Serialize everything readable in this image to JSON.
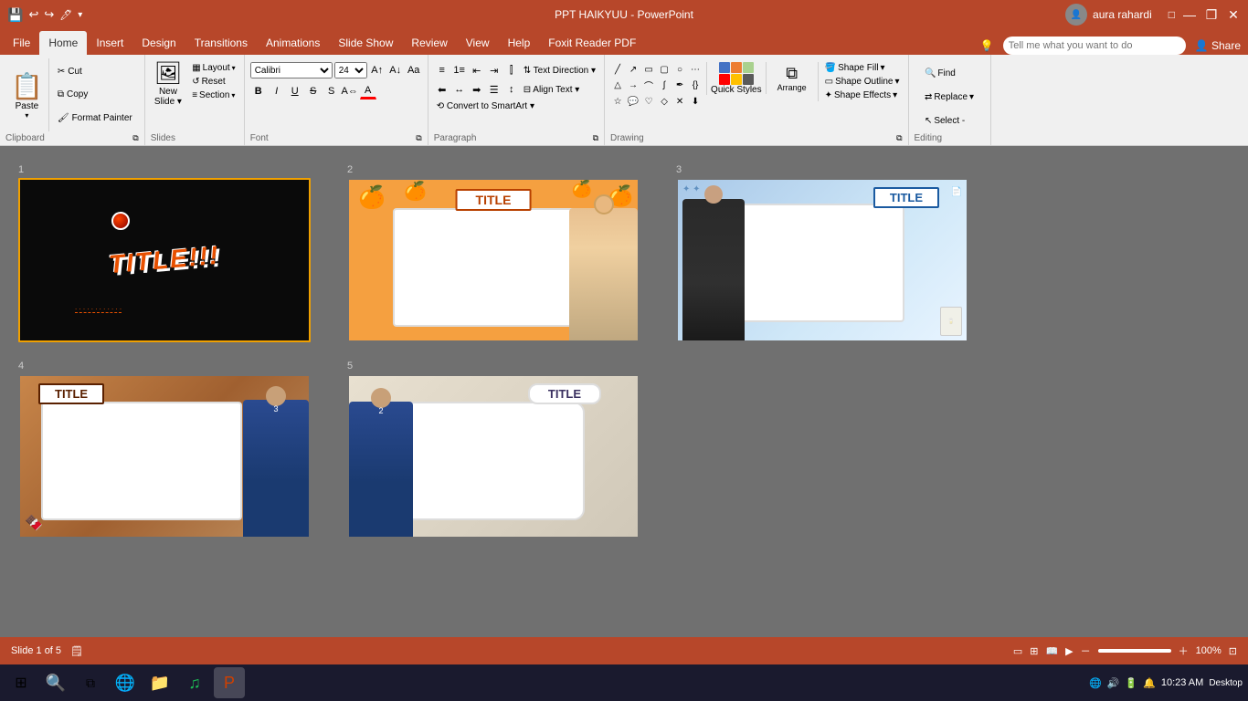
{
  "titlebar": {
    "title": "PPT HAIKYUU - PowerPoint",
    "user": "aura rahardi",
    "save_icon": "💾",
    "undo_icon": "↩",
    "redo_icon": "↪",
    "close": "✕",
    "minimize": "—",
    "maximize": "❐"
  },
  "ribbon": {
    "tabs": [
      "File",
      "Home",
      "Insert",
      "Design",
      "Transitions",
      "Animations",
      "Slide Show",
      "Review",
      "View",
      "Help",
      "Foxit Reader PDF"
    ],
    "active_tab": "Home",
    "tell_me": "Tell me what you want to do",
    "share": "Share",
    "groups": {
      "clipboard": {
        "label": "Clipboard",
        "paste": "Paste",
        "cut": "Cut",
        "copy": "Copy",
        "format_painter": "Format Painter"
      },
      "slides": {
        "label": "Slides",
        "new_slide": "New Slide",
        "layout": "Layout",
        "reset": "Reset",
        "section": "Section"
      },
      "font": {
        "label": "Font",
        "font_name": "Calibri",
        "font_size": "24",
        "bold": "B",
        "italic": "I",
        "underline": "U",
        "strikethrough": "S",
        "shadow": "S"
      },
      "paragraph": {
        "label": "Paragraph"
      },
      "drawing": {
        "label": "Drawing",
        "shape_fill": "Shape Fill",
        "shape_outline": "Shape Outline",
        "shape_effects": "Shape Effects",
        "quick_styles": "Quick Styles",
        "arrange": "Arrange"
      },
      "editing": {
        "label": "Editing",
        "find": "Find",
        "replace": "Replace",
        "select": "Select"
      }
    }
  },
  "slides": [
    {
      "number": "1",
      "title": "TITLE!!!",
      "theme": "black",
      "selected": true
    },
    {
      "number": "2",
      "title": "TITLE",
      "theme": "orange"
    },
    {
      "number": "3",
      "title": "TITLE",
      "theme": "blue"
    },
    {
      "number": "4",
      "title": "TITLE",
      "theme": "brown"
    },
    {
      "number": "5",
      "title": "TITLE",
      "theme": "grey"
    }
  ],
  "statusbar": {
    "slide_info": "Slide 1 of 5",
    "zoom": "100%",
    "view_icons": [
      "normal",
      "outline",
      "slide_sorter",
      "reading"
    ]
  },
  "taskbar": {
    "time": "10:23 AM",
    "date": "",
    "desktop": "Desktop",
    "items": [
      "⊞",
      "🔍",
      "🌐",
      "🎵",
      "🔴"
    ]
  }
}
